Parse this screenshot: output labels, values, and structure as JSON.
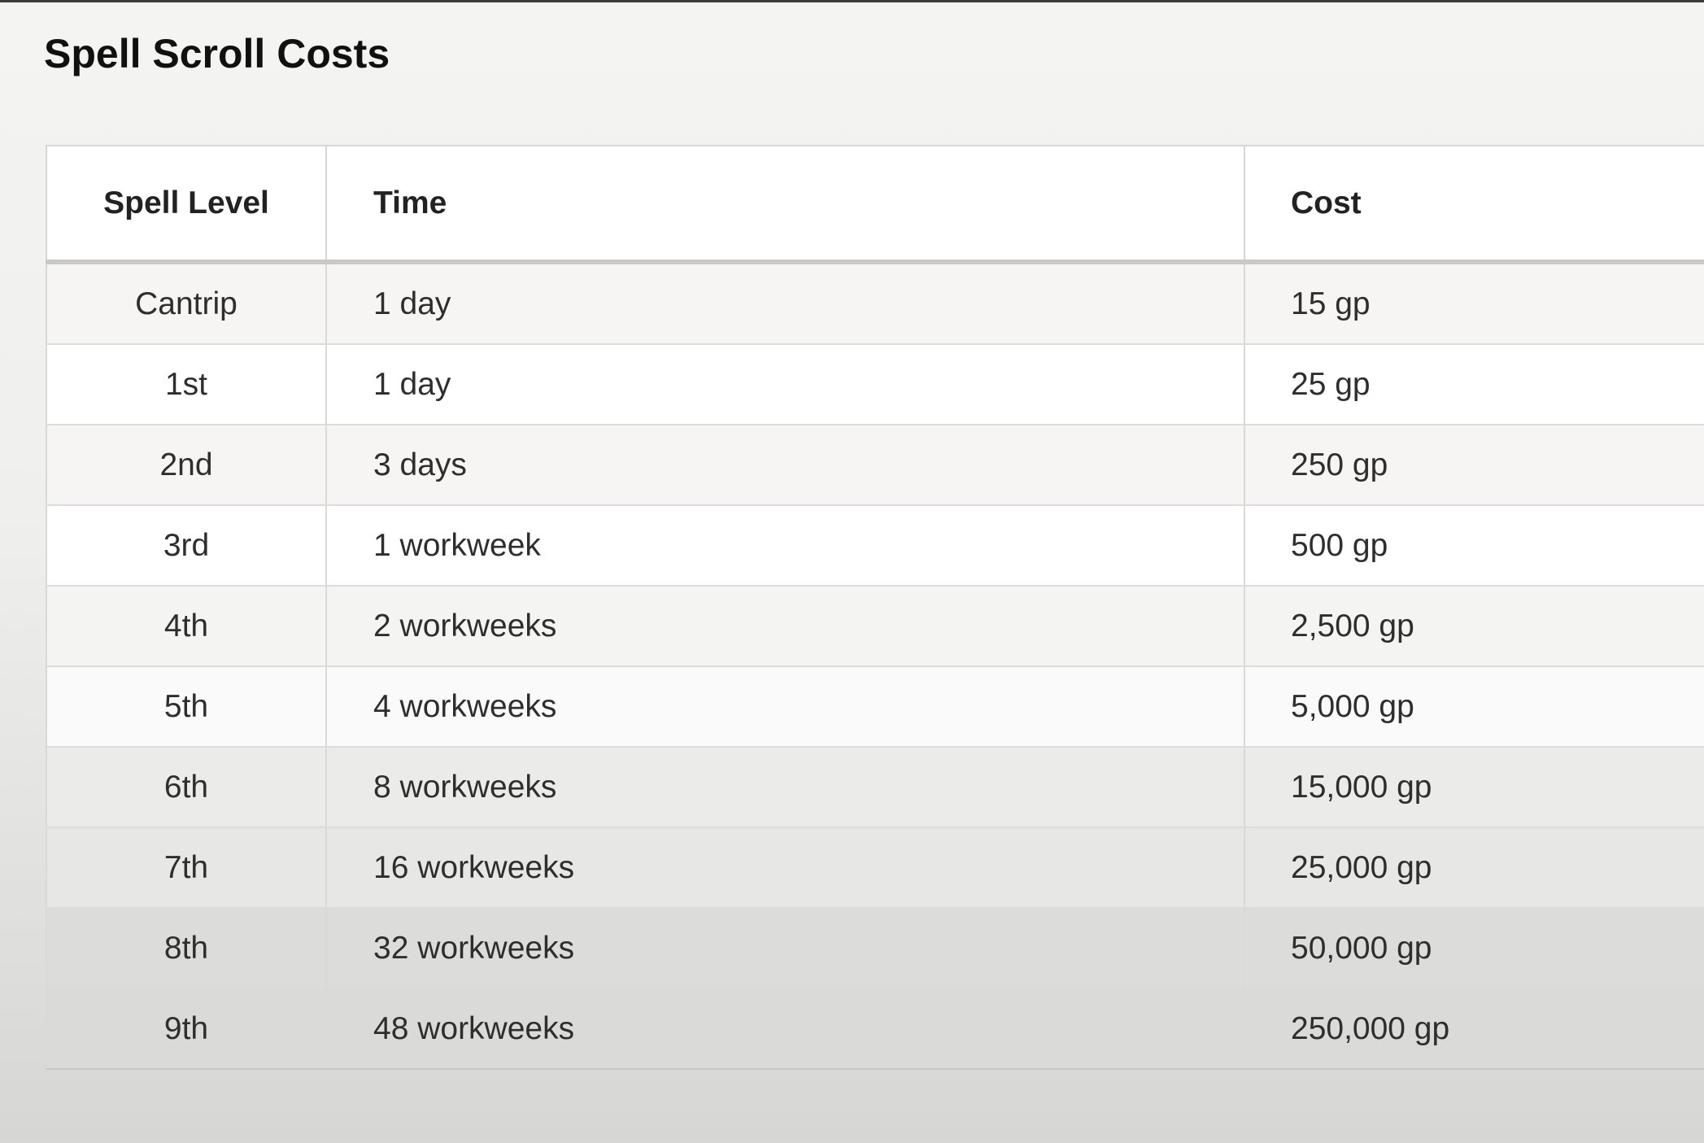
{
  "page": {
    "title": "Spell Scroll Costs"
  },
  "table": {
    "headers": {
      "level": "Spell Level",
      "time": "Time",
      "cost": "Cost"
    },
    "rows": [
      {
        "level": "Cantrip",
        "time": "1 day",
        "cost": "15 gp",
        "bg": "#f6f5f3"
      },
      {
        "level": "1st",
        "time": "1 day",
        "cost": "25 gp",
        "bg": "#ffffff"
      },
      {
        "level": "2nd",
        "time": "3 days",
        "cost": "250 gp",
        "bg": "#f6f5f3"
      },
      {
        "level": "3rd",
        "time": "1 workweek",
        "cost": "500 gp",
        "bg": "#ffffff"
      },
      {
        "level": "4th",
        "time": "2 workweeks",
        "cost": "2,500 gp",
        "bg": "#f4f4f2"
      },
      {
        "level": "5th",
        "time": "4 workweeks",
        "cost": "5,000 gp",
        "bg": "#fafafa"
      },
      {
        "level": "6th",
        "time": "8 workweeks",
        "cost": "15,000 gp",
        "bg": "#ebebea"
      },
      {
        "level": "7th",
        "time": "16 workweeks",
        "cost": "25,000 gp",
        "bg": "#e7e7e6"
      },
      {
        "level": "8th",
        "time": "32 workweeks",
        "cost": "50,000 gp",
        "bg": "#dcdcdb"
      },
      {
        "level": "9th",
        "time": "48 workweeks",
        "cost": "250,000 gp",
        "bg": "#dadad9"
      }
    ]
  }
}
